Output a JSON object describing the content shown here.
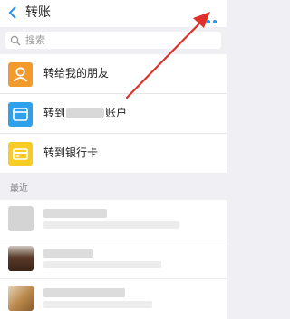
{
  "header": {
    "title": "转账"
  },
  "search": {
    "placeholder": "搜索"
  },
  "menu": {
    "items": [
      {
        "label": "转给我的朋友"
      },
      {
        "label_prefix": "转到",
        "label_suffix": "账户"
      },
      {
        "label": "转到银行卡"
      }
    ]
  },
  "recent": {
    "title": "最近"
  },
  "colors": {
    "accent": "#2b90e6",
    "annotation_arrow": "#e0302a",
    "tile_orange": "#f39a2c",
    "tile_blue": "#2ea0ec",
    "tile_yellow": "#f6cc25"
  },
  "icons": [
    "back-icon",
    "more-icon",
    "search-icon",
    "person-icon",
    "account-icon",
    "bank-card-icon"
  ]
}
